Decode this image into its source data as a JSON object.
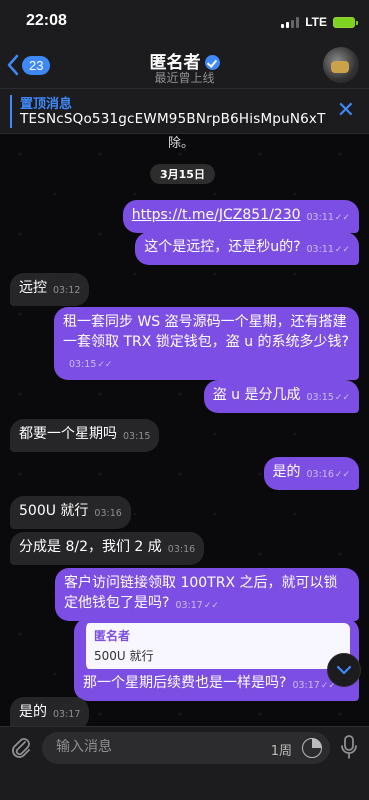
{
  "status_bar": {
    "time": "22:08",
    "network": "LTE"
  },
  "header": {
    "back_count": "23",
    "title": "匿名者",
    "subtitle": "最近曾上线"
  },
  "pinned": {
    "title": "置顶消息",
    "text": "TESNcSQo531gcEWM95BNrpB6HisMpuN6xT"
  },
  "chat": {
    "partial_text": "除。",
    "date_label": "3月15日",
    "messages": [
      {
        "dir": "out",
        "text": "https://t.me/JCZ851/230",
        "time": "03:11"
      },
      {
        "dir": "out",
        "text": "这个是远控，还是秒u的?",
        "time": "03:11"
      },
      {
        "dir": "in",
        "text": "远控",
        "time": "03:12"
      },
      {
        "dir": "out",
        "text": "租一套同步 WS 盗号源码一个星期，还有搭建一套领取 TRX 锁定钱包，盗 u 的系统多少钱?",
        "time": "03:15"
      },
      {
        "dir": "out",
        "text": "盗 u 是分几成",
        "time": "03:15"
      },
      {
        "dir": "in",
        "text": "都要一个星期吗",
        "time": "03:15"
      },
      {
        "dir": "out",
        "text": "是的",
        "time": "03:16"
      },
      {
        "dir": "in",
        "text": "500U 就行",
        "time": "03:16"
      },
      {
        "dir": "in",
        "text": "分成是 8/2，我们 2 成",
        "time": "03:16"
      },
      {
        "dir": "out",
        "text": "客户访问链接领取 100TRX 之后，就可以锁定他钱包了是吗?",
        "time": "03:17"
      },
      {
        "dir": "out",
        "reply_name": "匿名者",
        "reply_text": "500U 就行",
        "text": "那一个星期后续费也是一样是吗?",
        "time": "03:17"
      },
      {
        "dir": "in",
        "text": "是的",
        "time": "03:17"
      }
    ]
  },
  "input": {
    "placeholder": "输入消息",
    "timer": "1周"
  },
  "icons": {
    "back": "chevron-left-icon",
    "verified": "verified-icon",
    "close": "close-icon",
    "attach": "paperclip-icon",
    "mic": "microphone-icon",
    "scroll": "chevron-down-icon"
  },
  "colors": {
    "accent": "#3e88f7",
    "outgoing": "#7c4ee4",
    "incoming": "#262628"
  }
}
